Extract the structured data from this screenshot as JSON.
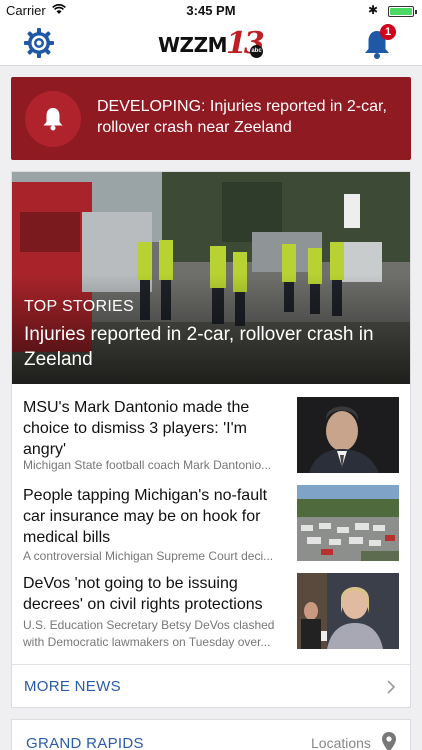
{
  "status_bar": {
    "carrier": "Carrier",
    "time": "3:45 PM",
    "bluetooth": "✱",
    "battery_level": 1.0
  },
  "nav": {
    "logo_text": "WZZM",
    "logo_number": "13",
    "logo_badge": "abc",
    "notification_count": "1",
    "accent_color": "#1f58a6"
  },
  "breaking": {
    "text": "DEVELOPING: Injuries reported in 2-car, rollover crash near Zeeland",
    "bg_color": "#8f1a22"
  },
  "top_story": {
    "section": "TOP STORIES",
    "headline": "Injuries reported in 2-car, rollover crash in Zeeland"
  },
  "stories": [
    {
      "title": "MSU's Mark Dantonio made the choice to dismiss 3 players: 'I'm angry'",
      "summary": "Michigan State football coach Mark Dantonio..."
    },
    {
      "title": "People tapping Michigan's no-fault car insurance may be on hook for medical bills",
      "summary": "A controversial Michigan Supreme Court deci..."
    },
    {
      "title": "DeVos 'not going to be issuing decrees' on civil rights protections",
      "summary": "U.S. Education Secretary Betsy DeVos clashed with Democratic lawmakers on Tuesday over..."
    }
  ],
  "more_news": {
    "label": "MORE NEWS"
  },
  "local": {
    "label": "GRAND RAPIDS",
    "locations_label": "Locations"
  }
}
